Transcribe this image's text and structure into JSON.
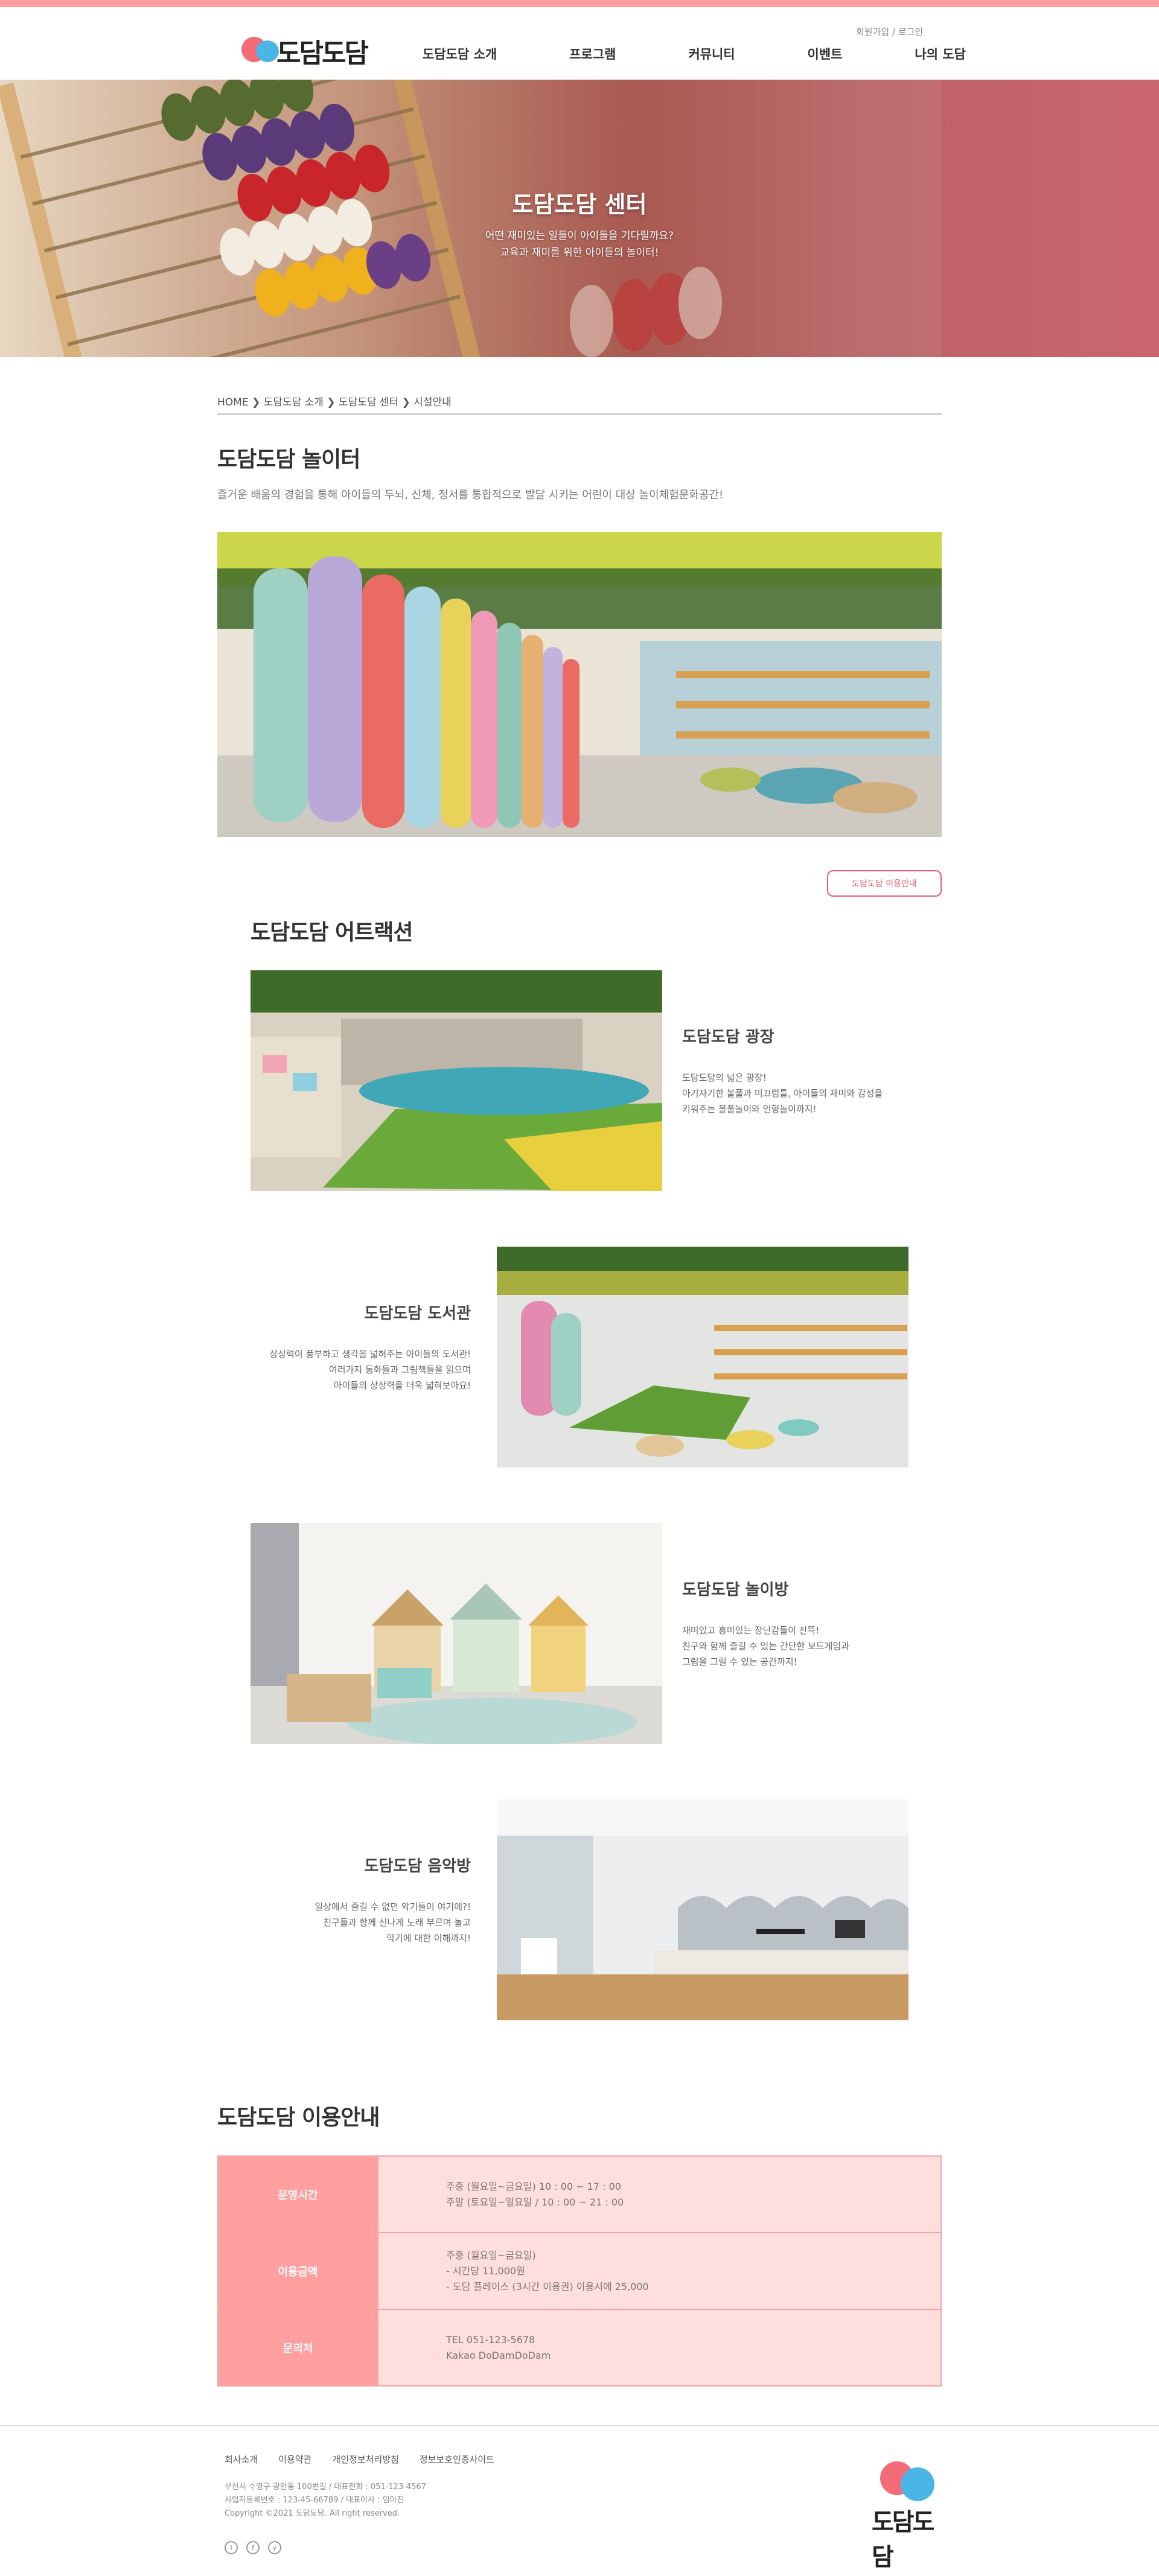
{
  "header": {
    "logo_text": "도담도담",
    "util_join": "회원가입",
    "util_sep": " / ",
    "util_login": "로그인",
    "nav": [
      "도담도담 소개",
      "프로그램",
      "커뮤니티",
      "이벤트",
      "나의 도담"
    ]
  },
  "hero": {
    "title": "도담도담 센터",
    "subtitle_1": "어떤 재미있는 일들이 아이들을 기다릴까요?",
    "subtitle_2": "교육과 재미를 위한 아이들의 놀이터!"
  },
  "breadcrumb": [
    "HOME",
    "도담도담 소개",
    "도담도담 센터",
    "시설안내"
  ],
  "section": {
    "title": "도담도담 놀이터",
    "desc": "즐거운 배움의 경험을 통해 아이들의 두뇌, 신체, 정서를 통합적으로 발달 시키는 어린이 대상 놀이체험문화공간!"
  },
  "guide_button": "도담도담 이용안내",
  "attractions_title": "도담도담 어트랙션",
  "attractions": [
    {
      "name": "도담도담 광장",
      "desc": "도담도담의 넓은 광장!\n아기자기한 볼풀과 미끄럼틀, 아이들의 재미와 감성을\n 키워주는 볼풀놀이와 인형놀이까지!"
    },
    {
      "name": "도담도담 도서관",
      "desc": "상상력이 풍부하고 생각을 넓혀주는 아이들의 도서관!\n여러가지 동화들과  그림책들을 읽으며\n아이들의 상상력을 더욱 넓혀보아요!"
    },
    {
      "name": "도담도담 놀이방",
      "desc": "재미있고 흥미있는 장난감들이 잔뜩!\n친구와 함께 즐길 수 있는 간단한 보드게임과\n그림을 그릴 수 있는 공간까지!"
    },
    {
      "name": "도담도담 음악방",
      "desc": "일상에서 즐길 수 없던 악기들이 여기에?!\n친구들과 함께 신나게 노래 부르며 놀고\n악기에 대한 이해까지!"
    }
  ],
  "info_title": "도담도담 이용안내",
  "info": [
    {
      "head": "운영시간",
      "lines": [
        "주중 (월요일~금요일) 10 : 00 ~ 17 : 00",
        "주말 (토요일~일요일 / 10 : 00 ~ 21 : 00"
      ]
    },
    {
      "head": "이용금액",
      "lines": [
        "주중 (월요일~금요일)",
        " - 시간당 11,000원",
        " - 도담 플레이스 (3시간 이용권) 이용시에 25,000"
      ]
    },
    {
      "head": "문의처",
      "lines": [
        "TEL 051-123-5678",
        "Kakao DoDamDoDam"
      ]
    }
  ],
  "footer": {
    "links": [
      "회사소개",
      "이용약관",
      "개인정보처리방침",
      "정보보호인증사이트"
    ],
    "info": [
      "부산시 수영구 광안동 100번길 / 대표전화 : 051-123-4567",
      "사업자등록번호 : 123-45-66789 / 대표이사 : 임아진",
      "Copyright ©2021 도담도담. All right reserved."
    ],
    "logo_text": "도담도담",
    "sns": [
      "I",
      "f",
      "y"
    ]
  },
  "colors": {
    "accent": "#ffa0a0",
    "button": "#e65c6a",
    "table_head": "#ff9f9f",
    "table_body": "#ffdede"
  }
}
